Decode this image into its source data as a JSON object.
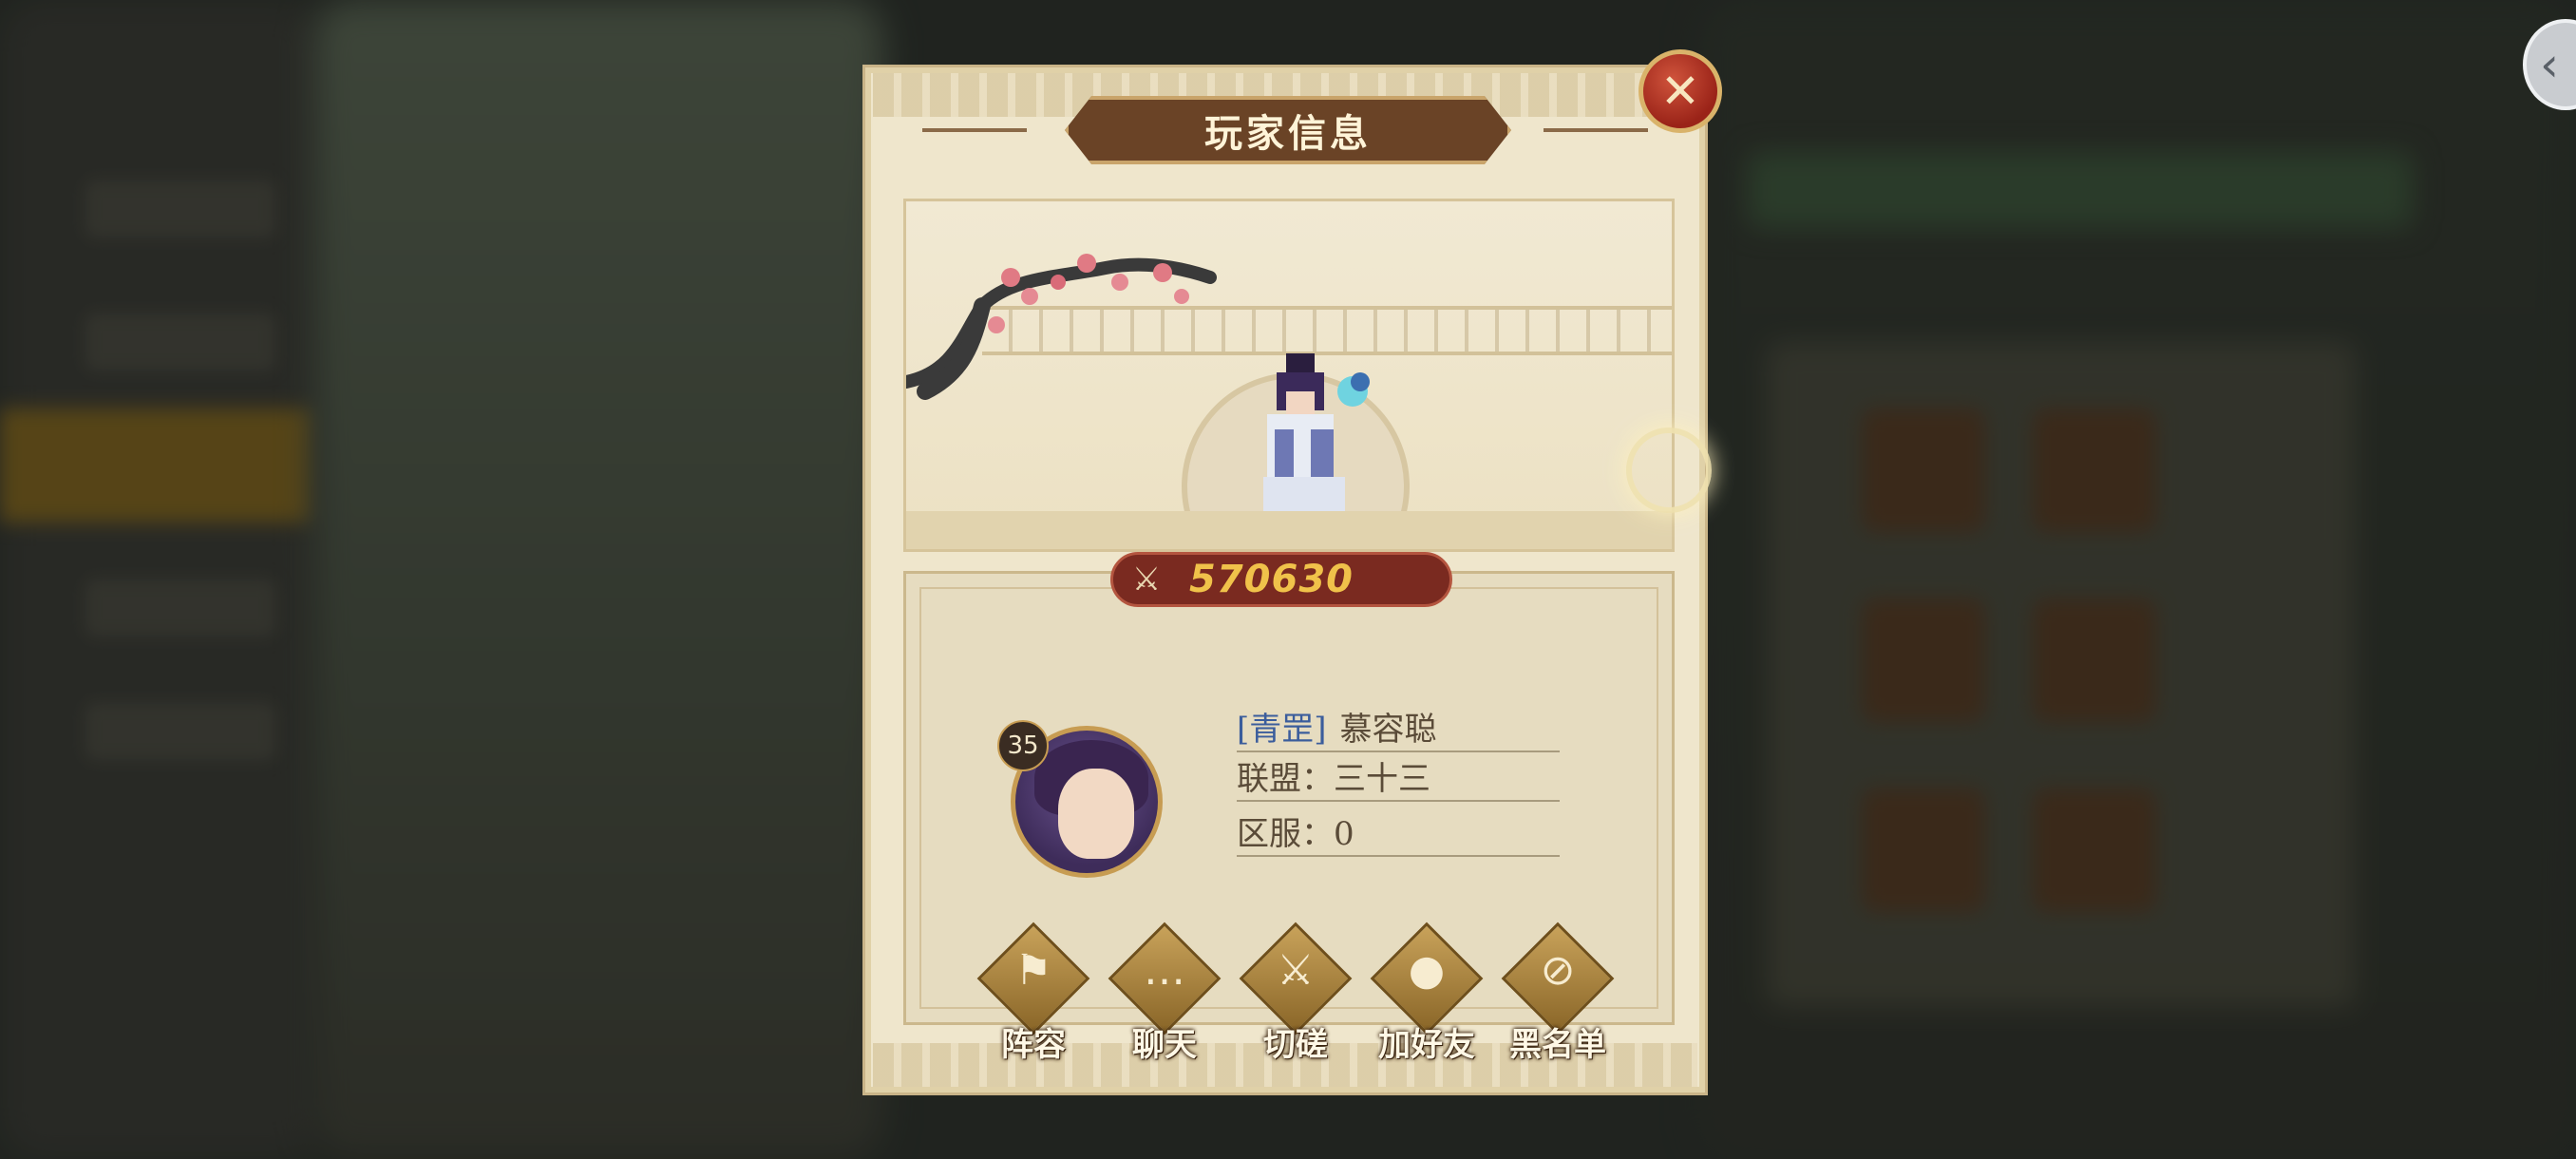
{
  "dialog": {
    "title": "玩家信息",
    "close_icon": "close-icon"
  },
  "player": {
    "power": "570630",
    "level": "35",
    "tag": "[青罡]",
    "name": "慕容聪",
    "alliance": "联盟：三十三",
    "server": "区服：0"
  },
  "actions": [
    {
      "label": "阵容",
      "icon": "flag-icon"
    },
    {
      "label": "聊天",
      "icon": "chat-bubble-icon"
    },
    {
      "label": "切磋",
      "icon": "crossed-swords-icon"
    },
    {
      "label": "加好友",
      "icon": "add-friend-icon"
    },
    {
      "label": "黑名单",
      "icon": "blacklist-icon"
    }
  ],
  "colors": {
    "panel": "#efe6cc",
    "title_plate": "#6a4326",
    "power_bg": "#7a2a20",
    "power_text": "#f0c24a",
    "close_red": "#b02e1e"
  }
}
